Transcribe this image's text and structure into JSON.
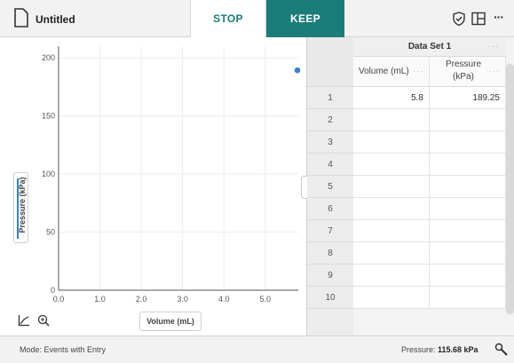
{
  "document": {
    "title": "Untitled"
  },
  "toolbar": {
    "stop_label": "STOP",
    "keep_label": "KEEP",
    "more_label": "···"
  },
  "graph": {
    "y_axis_label": "Pressure (kPa)",
    "x_axis_label": "Volume (mL)"
  },
  "chart_data": {
    "type": "scatter",
    "title": "",
    "xlabel": "Volume (mL)",
    "ylabel": "Pressure (kPa)",
    "xlim": [
      0,
      5.8
    ],
    "ylim": [
      0,
      210
    ],
    "x_ticks": [
      "0.0",
      "1.0",
      "2.0",
      "3.0",
      "4.0",
      "5.0"
    ],
    "y_ticks": [
      "0",
      "50",
      "100",
      "150",
      "200"
    ],
    "grid": true,
    "series": [
      {
        "x": [
          5.8
        ],
        "y": [
          189.25
        ],
        "color": "#3b82c4"
      }
    ]
  },
  "table": {
    "dataset_title": "Data Set 1",
    "dataset_more": "···",
    "col_more": "···",
    "columns": [
      "Volume (mL)",
      "Pressure",
      "(kPa)"
    ],
    "row_numbers": [
      "1",
      "2",
      "3",
      "4",
      "5",
      "6",
      "7",
      "8",
      "9",
      "10"
    ],
    "rows": [
      [
        "5.8",
        "189.25"
      ]
    ]
  },
  "status": {
    "mode": "Mode: Events with Entry",
    "sensor_label": "Pressure: ",
    "sensor_value": "115.68 kPa"
  },
  "colors": {
    "accent": "#1b7c79",
    "series": "#3b82c4"
  }
}
